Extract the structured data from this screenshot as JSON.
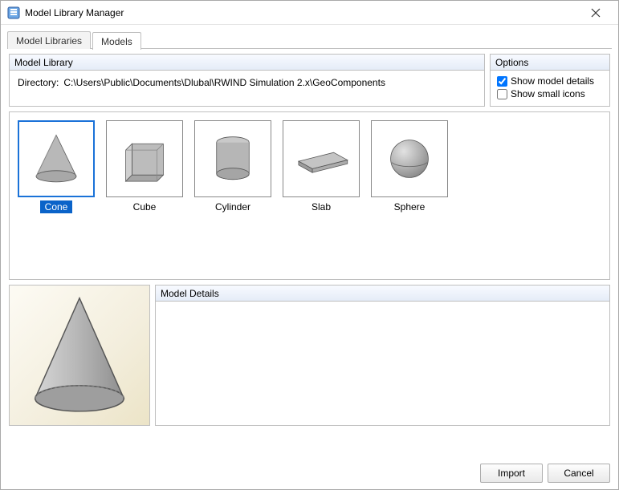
{
  "window": {
    "title": "Model Library Manager"
  },
  "tabs": {
    "libraries": "Model Libraries",
    "models": "Models"
  },
  "library_box": {
    "heading": "Model Library",
    "dir_label": "Directory:",
    "dir_path": "C:\\Users\\Public\\Documents\\Dlubal\\RWIND Simulation 2.x\\GeoComponents"
  },
  "options_box": {
    "heading": "Options",
    "show_details": "Show model details",
    "show_small": "Show small icons",
    "show_details_checked": true,
    "show_small_checked": false
  },
  "shapes": {
    "cone": "Cone",
    "cube": "Cube",
    "cylinder": "Cylinder",
    "slab": "Slab",
    "sphere": "Sphere"
  },
  "details_box": {
    "heading": "Model Details"
  },
  "footer": {
    "import": "Import",
    "cancel": "Cancel"
  }
}
